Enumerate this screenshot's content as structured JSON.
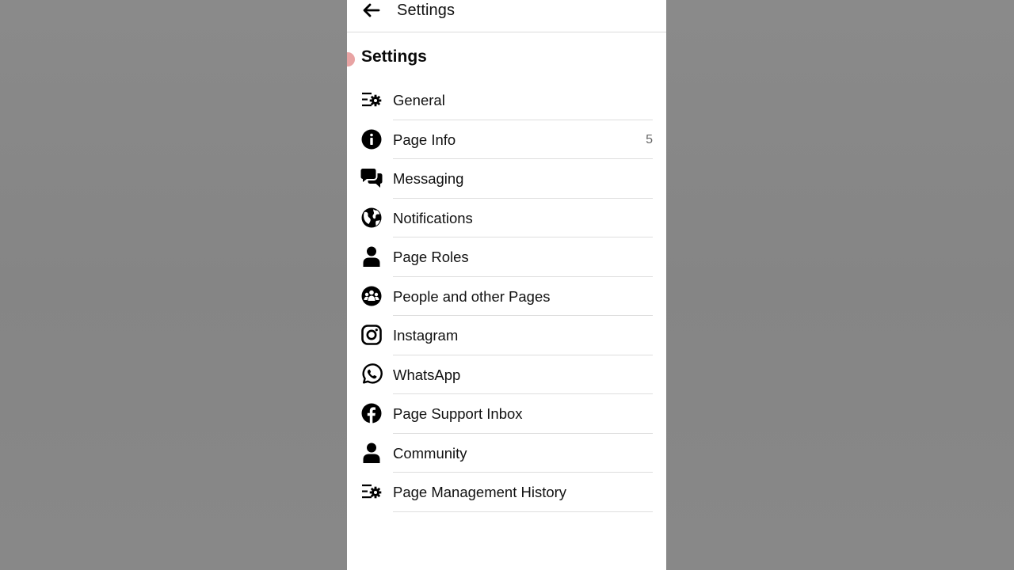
{
  "header": {
    "title": "Settings",
    "back_icon": "arrow-left-icon"
  },
  "section": {
    "title": "Settings"
  },
  "menu": {
    "items": [
      {
        "label": "General",
        "icon": "list-gear-icon",
        "count": ""
      },
      {
        "label": "Page Info",
        "icon": "info-icon",
        "count": "5"
      },
      {
        "label": "Messaging",
        "icon": "chat-bubbles-icon",
        "count": ""
      },
      {
        "label": "Notifications",
        "icon": "globe-icon",
        "count": ""
      },
      {
        "label": "Page Roles",
        "icon": "person-icon",
        "count": ""
      },
      {
        "label": "People and other Pages",
        "icon": "people-group-icon",
        "count": ""
      },
      {
        "label": "Instagram",
        "icon": "instagram-icon",
        "count": ""
      },
      {
        "label": "WhatsApp",
        "icon": "whatsapp-icon",
        "count": ""
      },
      {
        "label": "Page Support Inbox",
        "icon": "facebook-icon",
        "count": ""
      },
      {
        "label": "Community",
        "icon": "person-icon",
        "count": ""
      },
      {
        "label": "Page Management History",
        "icon": "list-gear-icon",
        "count": ""
      }
    ]
  },
  "colors": {
    "page_background": "#878787",
    "panel": "#ffffff",
    "text": "#111111",
    "divider": "#dedede",
    "touch_indicator": "#e8a3a3"
  }
}
